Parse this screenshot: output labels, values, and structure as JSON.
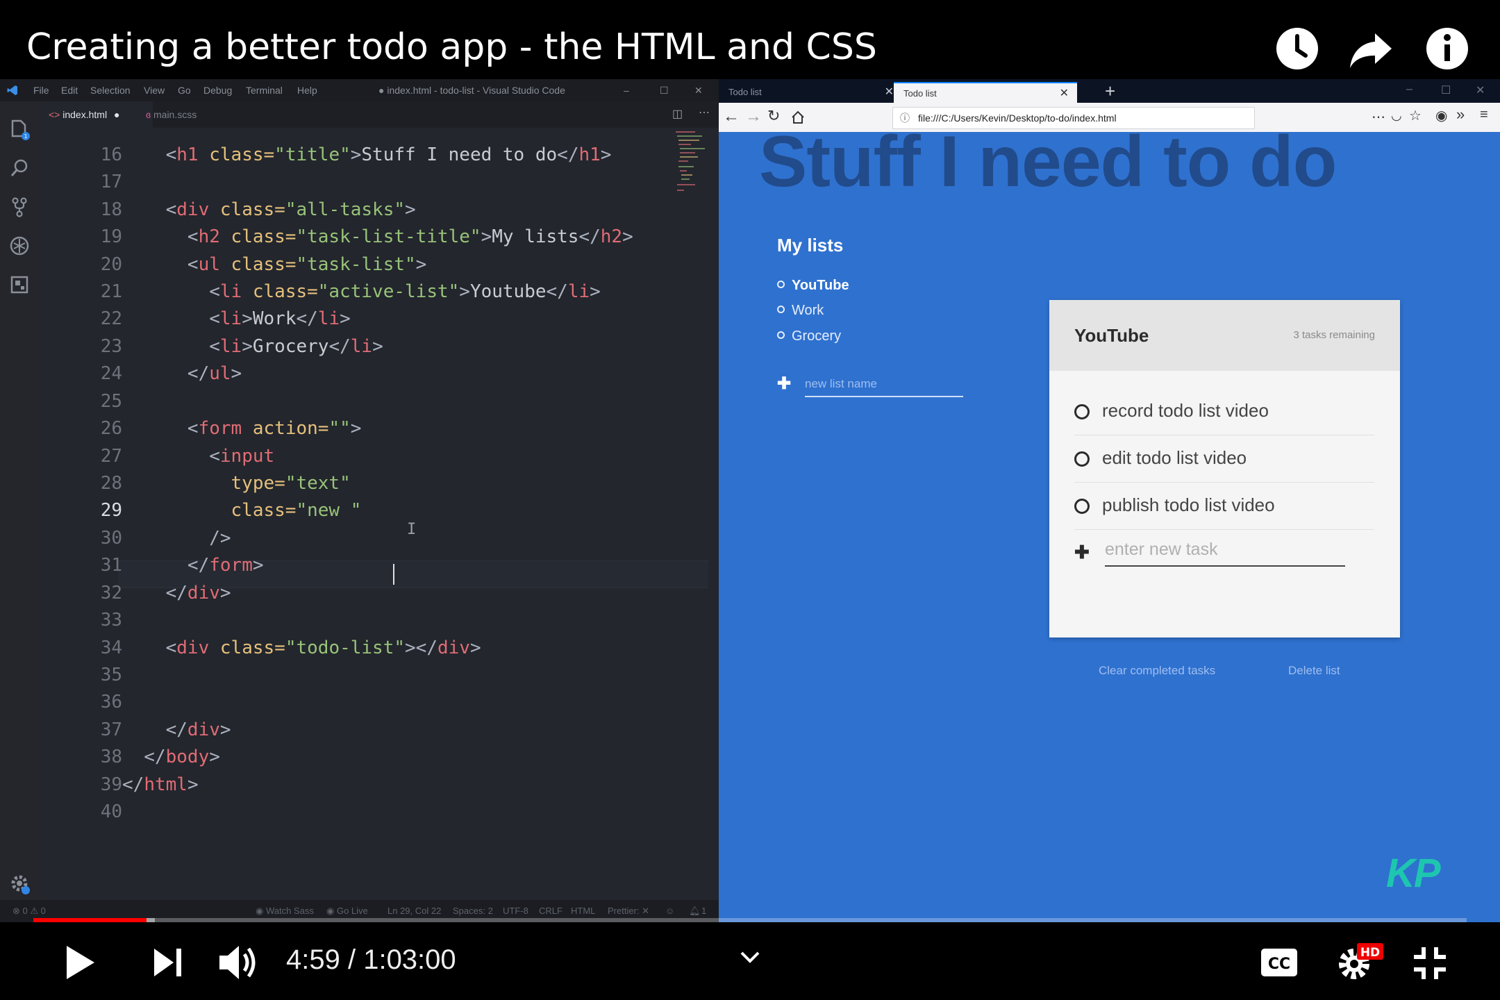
{
  "video": {
    "title": "Creating a better todo app - the HTML and CSS",
    "current_time": "4:59",
    "separator": " / ",
    "duration": "1:03:00",
    "progress_played": 0.079,
    "progress_buffered": 0.085
  },
  "vscode": {
    "menu": [
      "File",
      "Edit",
      "Selection",
      "View",
      "Go",
      "Debug",
      "Terminal",
      "Help"
    ],
    "window_title": "● index.html - todo-list - Visual Studio Code",
    "tabs": [
      {
        "label": "index.html",
        "modified": "●"
      },
      {
        "label": "main.scss"
      }
    ],
    "line_numbers": [
      "16",
      "17",
      "18",
      "19",
      "20",
      "21",
      "22",
      "23",
      "24",
      "25",
      "26",
      "27",
      "28",
      "29",
      "30",
      "31",
      "32",
      "33",
      "34",
      "35",
      "36",
      "37",
      "38",
      "39",
      "40"
    ],
    "current_line": "29",
    "status": {
      "problems": "⊗ 0  ⚠ 0",
      "watch_sass": "◉ Watch Sass",
      "go_live": "◉ Go Live",
      "position": "Ln 29, Col 22",
      "spaces": "Spaces: 2",
      "encoding": "UTF-8",
      "eol": "CRLF",
      "language": "HTML",
      "prettier": "Prettier: ✕",
      "bell": "1"
    }
  },
  "browser": {
    "tabs": [
      "Todo list",
      "Todo list"
    ],
    "url": "file:///C:/Users/Kevin/Desktop/to-do/index.html"
  },
  "page": {
    "title": "Stuff I need to do",
    "lists_title": "My lists",
    "lists": [
      "YouTube",
      "Work",
      "Grocery"
    ],
    "active_list": "YouTube",
    "new_list_placeholder": "new list name",
    "todo": {
      "title": "YouTube",
      "remaining": "3 tasks remaining",
      "tasks": [
        "record todo list video",
        "edit todo list video",
        "publish todo list video"
      ],
      "new_task_placeholder": "enter new task"
    },
    "clear_completed": "Clear completed tasks",
    "delete_list": "Delete list"
  },
  "branding": {
    "logo": "KP"
  },
  "colors": {
    "accent_red": "#ff0000",
    "page_blue": "#2f71cf",
    "kp_teal": "#1ec6b0"
  },
  "icons": [
    "watch-later-icon",
    "share-icon",
    "info-icon",
    "play-icon",
    "next-icon",
    "volume-icon",
    "chevron-down-icon",
    "captions-icon",
    "settings-icon",
    "exit-fullscreen-icon"
  ]
}
